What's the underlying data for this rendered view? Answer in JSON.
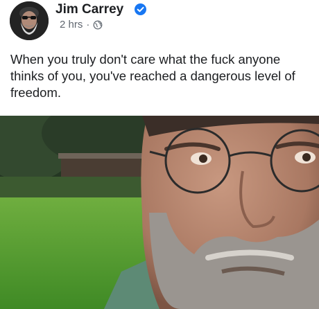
{
  "post": {
    "author_name": "Jim Carrey",
    "timestamp": "2 hrs",
    "separator": "·",
    "privacy_icon": "globe-icon",
    "verified_icon": "verified-badge-icon",
    "text": "When you truly don't care what the fuck anyone thinks of you, you've reached a dangerous level of freedom."
  },
  "colors": {
    "verified_blue": "#1877f2",
    "name_text": "#1c1e21",
    "meta_text": "#606770"
  }
}
